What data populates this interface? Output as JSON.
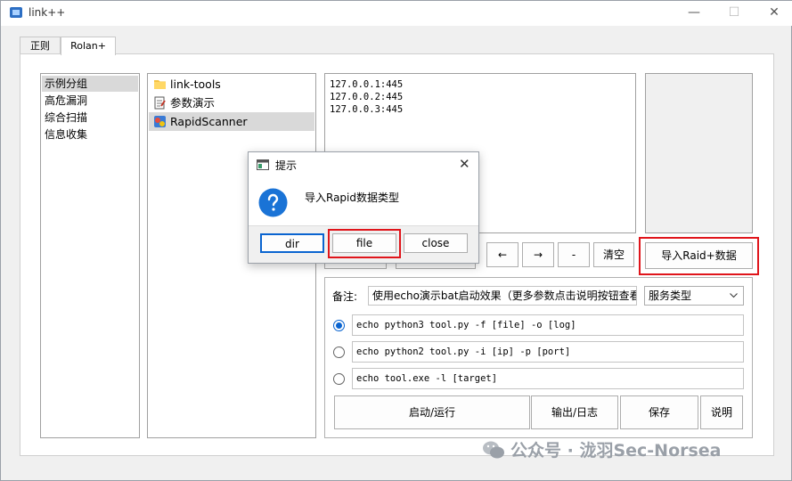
{
  "window": {
    "title": "link++",
    "min_glyph": "—",
    "max_glyph": "☐",
    "close_glyph": "✕"
  },
  "tabs": [
    {
      "label": "正则"
    },
    {
      "label": "Rolan+"
    }
  ],
  "categories": [
    {
      "label": "示例分组"
    },
    {
      "label": "高危漏洞"
    },
    {
      "label": "综合扫描"
    },
    {
      "label": "信息收集"
    }
  ],
  "tools": [
    {
      "label": "link-tools",
      "icon": "folder-icon"
    },
    {
      "label": "参数演示",
      "icon": "notepad-icon"
    },
    {
      "label": "RapidScanner",
      "icon": "app-icon"
    }
  ],
  "targets": [
    "127.0.0.1:445",
    "127.0.0.2:445",
    "127.0.0.3:445"
  ],
  "nav_buttons": {
    "left": "←",
    "right": "→",
    "minus": "-",
    "clear": "清空"
  },
  "import_button": "导入Raid+数据",
  "remark": {
    "label": "备注:",
    "value": "使用echo演示bat启动效果（更多参数点击说明按钮查看）",
    "service_type": "服务类型"
  },
  "commands": [
    {
      "text": "echo python3 tool.py -f [file] -o [log]",
      "selected": true
    },
    {
      "text": "echo python2 tool.py -i [ip] -p [port]",
      "selected": false
    },
    {
      "text": "echo tool.exe -l [target]",
      "selected": false
    }
  ],
  "actions": {
    "run": "启动/运行",
    "output": "输出/日志",
    "save": "保存",
    "help": "说明"
  },
  "dialog": {
    "title": "提示",
    "message": "导入Rapid数据类型",
    "dir": "dir",
    "file": "file",
    "close": "close",
    "close_glyph": "✕"
  },
  "watermark": "公众号 · 泷羽Sec-Norsea",
  "colors": {
    "accent": "#0a64d0",
    "highlight": "#e0151b"
  }
}
